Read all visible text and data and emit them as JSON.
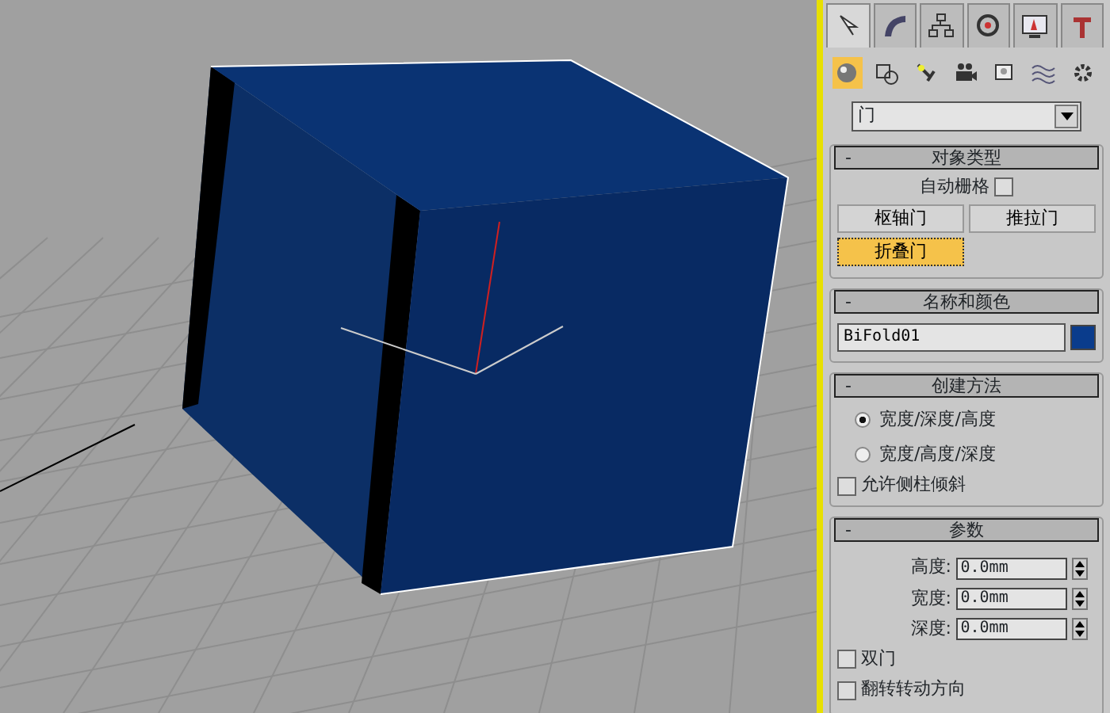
{
  "command_tabs": [
    {
      "kind": "create",
      "selected": true
    },
    {
      "kind": "modify",
      "selected": false
    },
    {
      "kind": "hierarchy",
      "selected": false
    },
    {
      "kind": "motion",
      "selected": false
    },
    {
      "kind": "display",
      "selected": false
    },
    {
      "kind": "utilities",
      "selected": false
    }
  ],
  "categories": [
    {
      "kind": "geometry",
      "selected": true
    },
    {
      "kind": "shapes",
      "selected": false
    },
    {
      "kind": "lights",
      "selected": false
    },
    {
      "kind": "cameras",
      "selected": false
    },
    {
      "kind": "helpers",
      "selected": false
    },
    {
      "kind": "spacewarps",
      "selected": false
    },
    {
      "kind": "systems",
      "selected": false
    }
  ],
  "dropdown": {
    "value": "门"
  },
  "object_type": {
    "toggle": "-",
    "title": "对象类型",
    "autogrid": {
      "label": "自动栅格",
      "checked": false
    },
    "buttons": [
      {
        "label": "枢轴门",
        "selected": false
      },
      {
        "label": "推拉门",
        "selected": false
      },
      {
        "label": "折叠门",
        "selected": true
      }
    ]
  },
  "name_and_color": {
    "toggle": "-",
    "title": "名称和颜色",
    "name": "BiFold01",
    "color": "#0a3c8c"
  },
  "creation_method": {
    "toggle": "-",
    "title": "创建方法",
    "options": [
      {
        "label": "宽度/深度/高度",
        "selected": true
      },
      {
        "label": "宽度/高度/深度",
        "selected": false
      }
    ],
    "checkbox": {
      "label": "允许侧柱倾斜",
      "checked": false
    }
  },
  "parameters": {
    "toggle": "-",
    "title": "参数",
    "fields": [
      {
        "label": "高度:",
        "value": "0.0mm"
      },
      {
        "label": "宽度:",
        "value": "0.0mm"
      },
      {
        "label": "深度:",
        "value": "0.0mm"
      }
    ],
    "checkboxes": [
      {
        "label": "双门",
        "checked": false
      },
      {
        "label": "翻转转动方向",
        "checked": false
      }
    ]
  }
}
